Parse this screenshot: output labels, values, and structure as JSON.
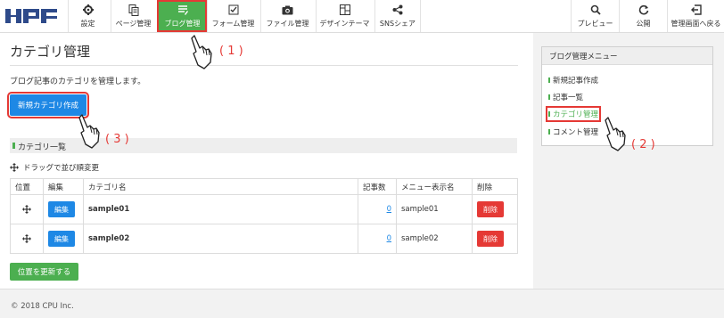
{
  "app": {
    "logo_text": "HPF"
  },
  "nav": {
    "settings": "設定",
    "page_mgmt": "ページ管理",
    "blog_mgmt": "ブログ管理",
    "form_mgmt": "フォーム管理",
    "file_mgmt": "ファイル管理",
    "design_theme": "デザインテーマ",
    "sns_share": "SNSシェア",
    "preview": "プレビュー",
    "publish": "公開",
    "back_to_admin": "管理画面へ戻る"
  },
  "main": {
    "title": "カテゴリ管理",
    "description": "ブログ記事のカテゴリを管理します。",
    "new_category_button": "新規カテゴリ作成",
    "section_title": "カテゴリ一覧",
    "drag_hint": "ドラッグで並び順変更",
    "table": {
      "headers": [
        "位置",
        "編集",
        "カテゴリ名",
        "記事数",
        "メニュー表示名",
        "削除"
      ],
      "rows": [
        {
          "edit": "編集",
          "name": "sample01",
          "count": "0",
          "menu_name": "sample01",
          "delete": "削除"
        },
        {
          "edit": "編集",
          "name": "sample02",
          "count": "0",
          "menu_name": "sample02",
          "delete": "削除"
        }
      ]
    },
    "update_position_button": "位置を更新する"
  },
  "sidebar": {
    "title": "ブログ管理メニュー",
    "items": [
      "新規記事作成",
      "記事一覧",
      "カテゴリ管理",
      "コメント管理"
    ]
  },
  "footer": {
    "copyright": "© 2018 CPU Inc."
  },
  "annotations": {
    "step1": "( 1 )",
    "step2": "( 2 )",
    "step3": "( 3 )"
  },
  "colors": {
    "accent_green": "#4caf50",
    "button_blue": "#1e88e5",
    "delete_red": "#e53935",
    "highlight_red": "#e53935"
  }
}
